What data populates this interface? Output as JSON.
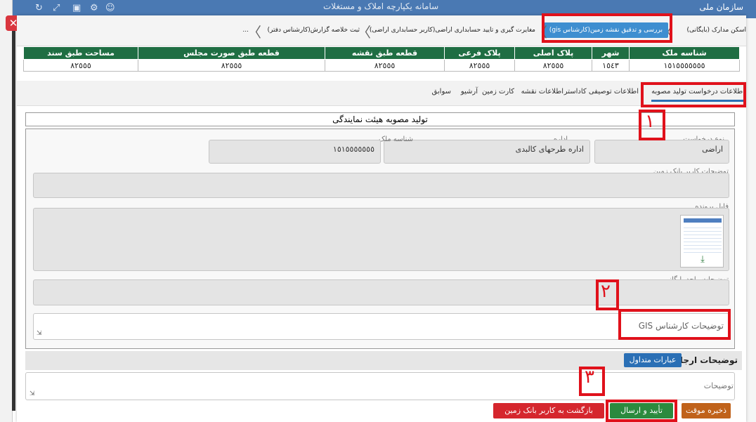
{
  "window": {
    "brand": "سازمان ملی",
    "title": "سامانه یکپارچه املاک و مستغلات",
    "close_symbol": "✕"
  },
  "workflow_steps": [
    {
      "label": "اسکن مدارک (بایگانی)"
    },
    {
      "label": "بررسی و تدقیق نقشه زمین(کارشناس gis)",
      "active": true
    },
    {
      "label": "مغایرت گیری و تایید حسابداری اراضی(کاربر حسابداری اراضی)"
    },
    {
      "label": "ثبت خلاصه گزارش(کارشناس دفتر)"
    },
    {
      "label": "..."
    }
  ],
  "property_table": {
    "headers": [
      "شناسه ملک",
      "شهر",
      "پلاک اصلی",
      "پلاک فرعی",
      "قطعه طبق نقشه",
      "قطعه طبق صورت مجلس",
      "مساحت طبق سند"
    ],
    "row": [
      "١٥١٥٥٥٥٥٥٥",
      "١٥٤٣",
      "٨٢٥٥٥",
      "٨٢٥٥٥",
      "٨٢٥٥٥",
      "٨٢٥٥٥",
      "٨٢٥٥٥"
    ]
  },
  "tabs": [
    "اطلاعات درخواست تولید مصوبه",
    "اطلاعات توصیفی کاداستر",
    "اطلاعات نقشه",
    "کارت زمین",
    "آرشیو",
    "سوابق"
  ],
  "section_title": "تولید مصوبه هیئت نمایندگی",
  "form": {
    "request_type_label": "نوع درخواست",
    "request_type_value": "اراضی",
    "office_label": "اداره",
    "office_value": "اداره طرحهای کالبدی",
    "property_id_label": "شناسه ملک",
    "property_id_value": "١٥١٥٥٥٥٥٥٥",
    "landbank_desc_label": "توضیحات کاربر بانک زمین",
    "file_label": "فایل پرونده",
    "archive_desc_label": "توضیحات واحد بایگانی",
    "gis_desc_placeholder": "توضیحات کارشناس GIS"
  },
  "refer": {
    "title": "توضیحات ارجاع کار",
    "phrases_button": "عبارات متداول",
    "desc_placeholder": "توضیحات"
  },
  "buttons": {
    "temp_save": "ذخیره موقت",
    "confirm_send": "تأیید و ارسال",
    "return_landbank": "بازگشت به کاربر بانک زمین"
  },
  "annotations": [
    "١",
    "٢",
    "٣"
  ],
  "icons": {
    "download": "⤓",
    "resize": "⇲"
  },
  "colors": {
    "table_header": "#1f6e43",
    "active_step": "#3e8ed0",
    "highlight": "#e0111b",
    "btn_save": "#c0621a",
    "btn_confirm": "#2b8a3e",
    "btn_return": "#d5262d"
  }
}
